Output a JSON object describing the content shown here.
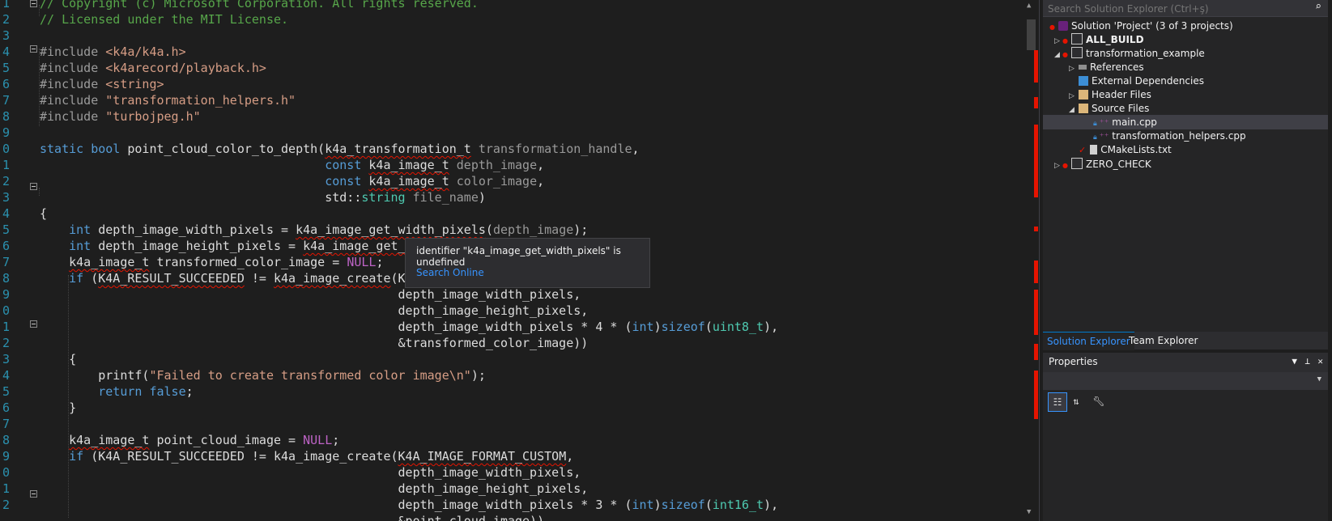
{
  "editor": {
    "line_numbers": [
      "1",
      "2",
      "3",
      "4",
      "5",
      "6",
      "7",
      "8",
      "9",
      "0",
      "1",
      "2",
      "3",
      "4",
      "5",
      "6",
      "7",
      "8",
      "9",
      "0",
      "1",
      "2",
      "3",
      "4",
      "5",
      "6",
      "7",
      "8",
      "9",
      "0",
      "1",
      "2"
    ],
    "lines": [
      [
        [
          "cm",
          "// Copyright (c) Microsoft Corporation. All rights reserved."
        ]
      ],
      [
        [
          "cm",
          "// Licensed under the MIT License."
        ]
      ],
      [],
      [
        [
          "pp",
          "#include "
        ],
        [
          "st",
          "<k4a/k4a.h>"
        ]
      ],
      [
        [
          "pp",
          "#include "
        ],
        [
          "st",
          "<k4arecord/playback.h>"
        ]
      ],
      [
        [
          "pp",
          "#include "
        ],
        [
          "st",
          "<string>"
        ]
      ],
      [
        [
          "pp",
          "#include "
        ],
        [
          "st",
          "\"transformation_helpers.h\""
        ]
      ],
      [
        [
          "pp",
          "#include "
        ],
        [
          "st",
          "\"turbojpeg.h\""
        ]
      ],
      [],
      [
        [
          "kw",
          "static "
        ],
        [
          "kw",
          "bool "
        ],
        [
          "",
          "point_cloud_color_to_depth("
        ],
        [
          "sq",
          "k4a_transformation_t"
        ],
        [
          "pm",
          " transformation_handle"
        ],
        [
          "",
          ","
        ]
      ],
      [
        [
          "",
          "                                       "
        ],
        [
          "kw",
          "const "
        ],
        [
          "sq",
          "k4a_image_t"
        ],
        [
          "pm",
          " depth_image"
        ],
        [
          "",
          ","
        ]
      ],
      [
        [
          "",
          "                                       "
        ],
        [
          "kw",
          "const "
        ],
        [
          "sq",
          "k4a_image_t"
        ],
        [
          "pm",
          " color_image"
        ],
        [
          "",
          ","
        ]
      ],
      [
        [
          "",
          "                                       std::"
        ],
        [
          "tp",
          "string"
        ],
        [
          "pm",
          " file_name"
        ],
        [
          "",
          ")"
        ]
      ],
      [
        [
          "",
          "{"
        ]
      ],
      [
        [
          "",
          "    "
        ],
        [
          "kw",
          "int "
        ],
        [
          "",
          "depth_image_width_pixels = "
        ],
        [
          "sq",
          "k4a_image_get_width_pixels"
        ],
        [
          "",
          "("
        ],
        [
          "pm",
          "depth_image"
        ],
        [
          "",
          ");"
        ]
      ],
      [
        [
          "",
          "    "
        ],
        [
          "kw",
          "int "
        ],
        [
          "",
          "depth_image_height_pixels = "
        ],
        [
          "sq",
          "k4a_image_get_"
        ]
      ],
      [
        [
          "",
          "    "
        ],
        [
          "sq",
          "k4a_image_t"
        ],
        [
          "",
          "",
          " transformed_color_image = "
        ],
        [
          "mac",
          "NULL"
        ],
        [
          "",
          ";"
        ]
      ],
      [
        [
          "",
          "    "
        ],
        [
          "kw",
          "if "
        ],
        [
          "",
          "("
        ],
        [
          "sq",
          "K4A_RESULT_SUCCEEDED"
        ],
        [
          "",
          " != "
        ],
        [
          "sq",
          "k4a_image_create"
        ],
        [
          "",
          "(K"
        ]
      ],
      [
        [
          "",
          "                                                 depth_image_width_pixels,"
        ]
      ],
      [
        [
          "",
          "                                                 depth_image_height_pixels,"
        ]
      ],
      [
        [
          "",
          "                                                 depth_image_width_pixels * 4 * ("
        ],
        [
          "kw",
          "int"
        ],
        [
          "",
          ")"
        ],
        [
          "kw",
          "sizeof"
        ],
        [
          "",
          "("
        ],
        [
          "tp",
          "uint8_t"
        ],
        [
          "",
          "),"
        ]
      ],
      [
        [
          "",
          "                                                 &transformed_color_image))"
        ]
      ],
      [
        [
          "",
          "    {"
        ]
      ],
      [
        [
          "",
          "        printf("
        ],
        [
          "st",
          "\"Failed to create transformed color image\\n\""
        ],
        [
          "",
          ");"
        ]
      ],
      [
        [
          "",
          "        "
        ],
        [
          "kw",
          "return "
        ],
        [
          "kw",
          "false"
        ],
        [
          "",
          ";"
        ]
      ],
      [
        [
          "",
          "    }"
        ]
      ],
      [],
      [
        [
          "",
          "    "
        ],
        [
          "sq",
          "k4a_image_t"
        ],
        [
          "",
          " point_cloud_image = "
        ],
        [
          "mac",
          "NULL"
        ],
        [
          "",
          ";"
        ]
      ],
      [
        [
          "",
          "    "
        ],
        [
          "kw",
          "if "
        ],
        [
          "",
          "(K4A_RESULT_SUCCEEDED != k4a_image_create("
        ],
        [
          "sq",
          "K4A_IMAGE_FORMAT_CUSTOM"
        ],
        [
          "",
          ","
        ]
      ],
      [
        [
          "",
          "                                                 depth_image_width_pixels,"
        ]
      ],
      [
        [
          "",
          "                                                 depth_image_height_pixels,"
        ]
      ],
      [
        [
          "",
          "                                                 depth_image_width_pixels * 3 * ("
        ],
        [
          "kw",
          "int"
        ],
        [
          "",
          ")"
        ],
        [
          "kw",
          "sizeof"
        ],
        [
          "",
          "("
        ],
        [
          "tp",
          "int16_t"
        ],
        [
          "",
          "),"
        ]
      ],
      [
        [
          "",
          "                                                 &point_cloud_image))"
        ]
      ]
    ]
  },
  "tooltip": {
    "message": "identifier \"k4a_image_get_width_pixels\" is undefined",
    "link": "Search Online"
  },
  "solution_explorer": {
    "search_placeholder": "Search Solution Explorer (Ctrl+ş)",
    "solution": "Solution 'Project' (3 of 3 projects)",
    "all_build": "ALL_BUILD",
    "transformation_example": "transformation_example",
    "references": "References",
    "external_dependencies": "External Dependencies",
    "header_files": "Header Files",
    "source_files": "Source Files",
    "main_cpp": "main.cpp",
    "helpers_cpp": "transformation_helpers.cpp",
    "cmakelists": "CMakeLists.txt",
    "zero_check": "ZERO_CHECK"
  },
  "tabs": {
    "solution_explorer": "Solution Explorer",
    "team_explorer": "Team Explorer"
  },
  "properties": {
    "title": "Properties"
  },
  "colors": {
    "editor_bg": "#1e1e1e",
    "accent": "#007acc",
    "error": "#e51400",
    "keyword": "#569cd6",
    "comment": "#57a64a",
    "string": "#d69d85",
    "type": "#4ec9b0"
  }
}
